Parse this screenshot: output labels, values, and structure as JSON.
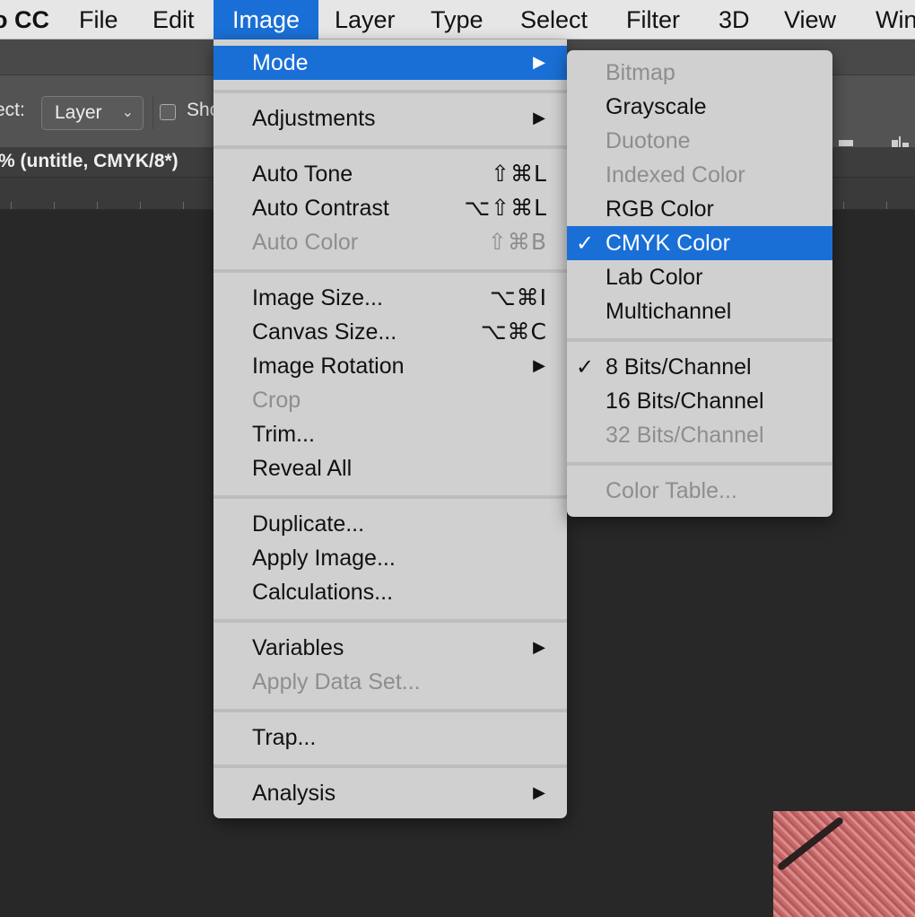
{
  "menubar": {
    "app_name": "o CC",
    "items": [
      {
        "label": "File"
      },
      {
        "label": "Edit"
      },
      {
        "label": "Image",
        "active": true
      },
      {
        "label": "Layer"
      },
      {
        "label": "Type"
      },
      {
        "label": "Select"
      },
      {
        "label": "Filter"
      },
      {
        "label": "3D"
      },
      {
        "label": "View"
      },
      {
        "label": "Win"
      }
    ]
  },
  "options_bar": {
    "select_label": "ect:",
    "layer_select_value": "Layer",
    "show_label": "Sho"
  },
  "document": {
    "tab_title": "% (untitle, CMYK/8*)"
  },
  "image_menu": {
    "items": [
      {
        "label": "Mode",
        "submenu": true,
        "highlighted": true
      },
      {
        "divider": true
      },
      {
        "label": "Adjustments",
        "submenu": true
      },
      {
        "divider": true
      },
      {
        "label": "Auto Tone",
        "shortcut": "⇧⌘L"
      },
      {
        "label": "Auto Contrast",
        "shortcut": "⌥⇧⌘L"
      },
      {
        "label": "Auto Color",
        "shortcut": "⇧⌘B",
        "disabled": true
      },
      {
        "divider": true
      },
      {
        "label": "Image Size...",
        "shortcut": "⌥⌘I"
      },
      {
        "label": "Canvas Size...",
        "shortcut": "⌥⌘C"
      },
      {
        "label": "Image Rotation",
        "submenu": true
      },
      {
        "label": "Crop",
        "disabled": true
      },
      {
        "label": "Trim..."
      },
      {
        "label": "Reveal All"
      },
      {
        "divider": true
      },
      {
        "label": "Duplicate..."
      },
      {
        "label": "Apply Image..."
      },
      {
        "label": "Calculations..."
      },
      {
        "divider": true
      },
      {
        "label": "Variables",
        "submenu": true
      },
      {
        "label": "Apply Data Set...",
        "disabled": true
      },
      {
        "divider": true
      },
      {
        "label": "Trap..."
      },
      {
        "divider": true
      },
      {
        "label": "Analysis",
        "submenu": true
      }
    ],
    "submenu_arrow": "▶"
  },
  "mode_submenu": {
    "check_glyph": "✓",
    "items": [
      {
        "label": "Bitmap",
        "disabled": true
      },
      {
        "label": "Grayscale"
      },
      {
        "label": "Duotone",
        "disabled": true
      },
      {
        "label": "Indexed Color",
        "disabled": true
      },
      {
        "label": "RGB Color"
      },
      {
        "label": "CMYK Color",
        "checked": true,
        "highlighted": true
      },
      {
        "label": "Lab Color"
      },
      {
        "label": "Multichannel"
      },
      {
        "divider": true
      },
      {
        "label": "8 Bits/Channel",
        "checked": true
      },
      {
        "label": "16 Bits/Channel"
      },
      {
        "label": "32 Bits/Channel",
        "disabled": true
      },
      {
        "divider": true
      },
      {
        "label": "Color Table...",
        "disabled": true
      }
    ]
  },
  "colors": {
    "accent": "#1a6fd6",
    "menu_bg": "#d0d0d0",
    "workspace_bg": "#282828"
  }
}
